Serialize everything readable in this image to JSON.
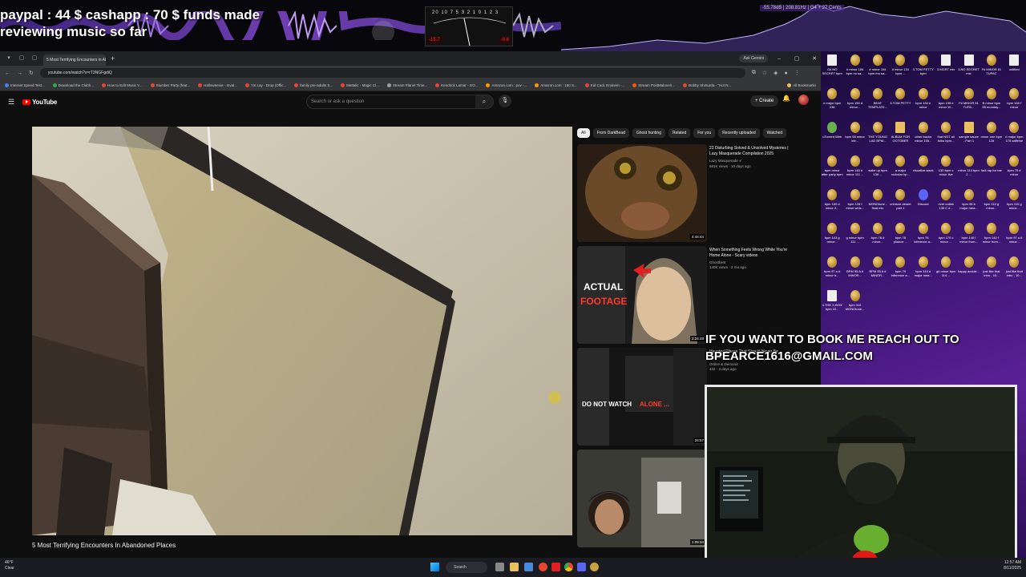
{
  "overlay": {
    "funds_line1": "paypal : 44 $  cashapp : 70 $ funds made",
    "funds_line2": "reviewing music so far",
    "vu_scale": "20 10 7 5 3 2 1 0 1 2 3",
    "vu_left": "-15.7",
    "vu_right": "-9.8",
    "spectrum_readout": "-55.78dB | 208.81Hz | G4 + 27 Cents",
    "booking_line1": "IF YOU WANT TO BOOK ME REACH OUT TO",
    "booking_line2": "BPEARCE1616@GMAIL.COM"
  },
  "browser": {
    "tab_title": "5 Most Terrifying Encounters in Ab...",
    "ask_gemini": "Ask Gemini",
    "url": "youtube.com/watch?v=rT3NGFgdiQ",
    "bookmarks": [
      {
        "label": "Internet Speed Test...",
        "color": "#4285f4"
      },
      {
        "label": "Download the Clubh...",
        "color": "#34a853"
      },
      {
        "label": "How to Edit Music V...",
        "color": "#ea4335"
      },
      {
        "label": "Slumber Party (feat...",
        "color": "#ea4335"
      },
      {
        "label": "Halloweenie - Inval...",
        "color": "#ea4335"
      },
      {
        "label": "Yin Lay - Drop (Offic...",
        "color": "#ea4335"
      },
      {
        "label": "family pre-adults S...",
        "color": "#ea4335"
      },
      {
        "label": "Mettalic - Magic Cl...",
        "color": "#ea4335"
      },
      {
        "label": "Stream Planet Time...",
        "color": "#9aa0a6"
      },
      {
        "label": "Kendrick Lamar - GO...",
        "color": "#ea4335"
      },
      {
        "label": "Amazon.com : pov -...",
        "color": "#ff9900"
      },
      {
        "label": "Amazon.com : 150 S...",
        "color": "#ff9900"
      },
      {
        "label": "Kid Cudi, Eminem -...",
        "color": "#ea4335"
      },
      {
        "label": "Stream PostMalone/I...",
        "color": "#ff5500"
      },
      {
        "label": "Bobby Shmurda - \"Hot N...",
        "color": "#ea4335"
      }
    ],
    "all_bookmarks": "All Bookmarks"
  },
  "youtube": {
    "logo_text": "YouTube",
    "search_placeholder": "Search or ask a question",
    "create_label": "+ Create",
    "video_title": "5 Most Terrifying Encounters In Abandoned Places",
    "chips": [
      "All",
      "From DarkBead",
      "Ghost hunting",
      "Related",
      "For you",
      "Recently uploaded",
      "Watched"
    ],
    "recommendations": [
      {
        "title": "23 Disturbing Solved & Unsolved Mysteries | Lazy Masquerade Compilation 2025",
        "channel": "Lazy Masquerade ✔",
        "meta": "581K views · 10 days ago",
        "duration": "4:44:44",
        "thumb_text": ""
      },
      {
        "title": "When Something Feels Wrong While You're Home Alone - Scary videos",
        "channel": "Ghostbest",
        "meta": "140K views · 2 mo ago",
        "duration": "2:24:48",
        "thumb_text": "ACTUAL",
        "thumb_text2": "FOOTAGE"
      },
      {
        "title": "Haunted Places That Should Never Be Visited",
        "channel": "Online & Demonic",
        "meta": "432 · 4 days ago",
        "duration": "24:57",
        "thumb_text": "DO NOT WATCH",
        "thumb_text2": "ALONE ..."
      },
      {
        "title": "",
        "channel": "",
        "meta": "",
        "duration": "1:09:34",
        "thumb_text": ""
      }
    ]
  },
  "desktop_icons": [
    "G# NO SECRET bpm",
    "# minor 154 bpm no sa...",
    "# minor 154 bpm mo sa...",
    "# minor 134 bpm ...",
    "3.TOM PETTY bpm",
    "3.MGRT mix",
    "3.NO SECRET mix",
    "F# MINOR 81 TUPAC",
    "untitled",
    "e major bpm 138",
    "bpm 150 d minor...",
    "BEAT TEMPLATE...",
    "3.TOM PETTY",
    "bpm 130 e minor",
    "bpm 135 e minor W...",
    "F# MINOR 81 TUPA...",
    "B minor bpm 85 monday...",
    "bpm 160 f minor",
    "uTorrent Web",
    "bpm 98 minor intr...",
    "THE YOUNG LAD BPM...",
    "ALBUM FOR OCTOBER",
    "other tracks minor 155...",
    "that NOT all folks bpm...",
    "sample sauce - Part 1",
    "minor one bpm 128",
    "# major bpm 175 caffeine",
    "bpm minor after party bpm",
    "bpm 148 # minor 111 ...",
    "wake up bpm 138 ...",
    "a major rockstar bp...",
    "visualize wack",
    "130 bpm c minor live",
    "minor 114 bpm 2 ...",
    "fadi rap for rae",
    "bpm 75 # minor",
    "bpm 160 d minor 2...",
    "bpm 128 f minor whis...",
    "MONOtone - final mix",
    "crimson desert part 1",
    "Discord",
    "river collab 135 C #...",
    "bpm 96 b major mea...",
    "bpm 110 g minor...",
    "bpm 110 g minor...",
    "bpm 103 g minor...",
    "g minor bpm 111 ...",
    "bpm 78 # minor...",
    "bpm 78 pliance ...",
    "bpm 78 inference a...",
    "bpm 170 c minor ...",
    "bpm 140 f minor from...",
    "bpm 140 f minor from...",
    "bpm 97 a # minor...",
    "bpm 97 a # minor b...",
    "BPM 95 A # MINOR...",
    "BPM 95 A # MINOR...",
    "bpm 79 inference a...",
    "bpm 144 d major mea...",
    "g# minor bpm 114 ...",
    "happy accide...",
    "just like that intro - 10...",
    "just like that intro - 10...",
    "4.THE X-BOX bpm 10...",
    "bpm 110 MONOtone..."
  ],
  "taskbar": {
    "weather_temp": "46°F",
    "weather_desc": "Clear",
    "search_label": "Search",
    "time": "12:57 AM",
    "date": "8/11/2025"
  }
}
